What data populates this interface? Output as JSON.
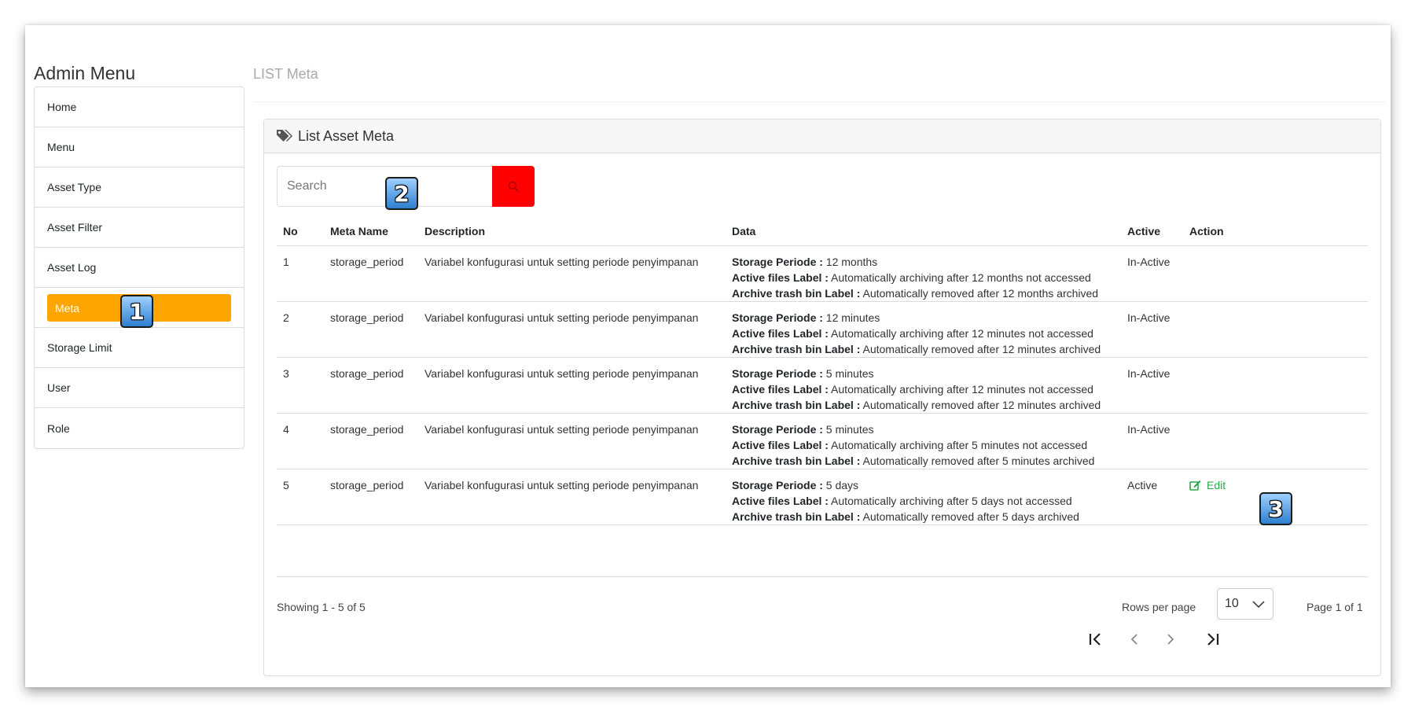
{
  "sidebar": {
    "title": "Admin Menu",
    "items": [
      {
        "label": "Home"
      },
      {
        "label": "Menu"
      },
      {
        "label": "Asset Type"
      },
      {
        "label": "Asset Filter"
      },
      {
        "label": "Asset Log"
      },
      {
        "label": "Meta",
        "active": true
      },
      {
        "label": "Storage Limit"
      },
      {
        "label": "User"
      },
      {
        "label": "Role"
      }
    ]
  },
  "page": {
    "title": "LIST Meta"
  },
  "card": {
    "title": "List Asset Meta",
    "icon": "tags-icon"
  },
  "search": {
    "placeholder": "Search",
    "button_icon": "search-icon"
  },
  "table": {
    "columns": [
      "No",
      "Meta Name",
      "Description",
      "Data",
      "Active",
      "Action"
    ],
    "rows": [
      {
        "no": "1",
        "meta_name": "storage_period",
        "description": "Variabel konfugurasi untuk setting periode penyimpanan",
        "data": [
          {
            "label": "Storage Periode :",
            "value": " 12 months"
          },
          {
            "label": "Active files Label :",
            "value": " Automatically archiving after 12 months not accessed"
          },
          {
            "label": "Archive trash bin Label :",
            "value": " Automatically removed after 12 months archived"
          }
        ],
        "active": "In-Active",
        "action": ""
      },
      {
        "no": "2",
        "meta_name": "storage_period",
        "description": "Variabel konfugurasi untuk setting periode penyimpanan",
        "data": [
          {
            "label": "Storage Periode :",
            "value": " 12 minutes"
          },
          {
            "label": "Active files Label :",
            "value": " Automatically archiving after 12 minutes not accessed"
          },
          {
            "label": "Archive trash bin Label :",
            "value": " Automatically removed after 12 minutes archived"
          }
        ],
        "active": "In-Active",
        "action": ""
      },
      {
        "no": "3",
        "meta_name": "storage_period",
        "description": "Variabel konfugurasi untuk setting periode penyimpanan",
        "data": [
          {
            "label": "Storage Periode :",
            "value": " 5 minutes"
          },
          {
            "label": "Active files Label :",
            "value": " Automatically archiving after 12 minutes not accessed"
          },
          {
            "label": "Archive trash bin Label :",
            "value": " Automatically removed after 12 minutes archived"
          }
        ],
        "active": "In-Active",
        "action": ""
      },
      {
        "no": "4",
        "meta_name": "storage_period",
        "description": "Variabel konfugurasi untuk setting periode penyimpanan",
        "data": [
          {
            "label": "Storage Periode :",
            "value": " 5 minutes"
          },
          {
            "label": "Active files Label :",
            "value": " Automatically archiving after 5 minutes not accessed"
          },
          {
            "label": "Archive trash bin Label :",
            "value": " Automatically removed after 5 minutes archived"
          }
        ],
        "active": "In-Active",
        "action": ""
      },
      {
        "no": "5",
        "meta_name": "storage_period",
        "description": "Variabel konfugurasi untuk setting periode penyimpanan",
        "data": [
          {
            "label": "Storage Periode :",
            "value": " 5 days"
          },
          {
            "label": "Active files Label :",
            "value": " Automatically archiving after 5 days not accessed"
          },
          {
            "label": "Archive trash bin Label :",
            "value": " Automatically removed after 5 days archived"
          }
        ],
        "active": "Active",
        "action": "Edit"
      }
    ]
  },
  "pagination": {
    "showing": "Showing 1 - 5 of 5",
    "rows_label": "Rows per page",
    "rows_value": "10",
    "page_info": "Page 1 of 1"
  },
  "annotations": [
    "1",
    "2",
    "3"
  ],
  "colors": {
    "accent": "#ffa500",
    "search_button": "#ff0000",
    "edit": "#28a745",
    "badge": "#2e7fd0"
  }
}
